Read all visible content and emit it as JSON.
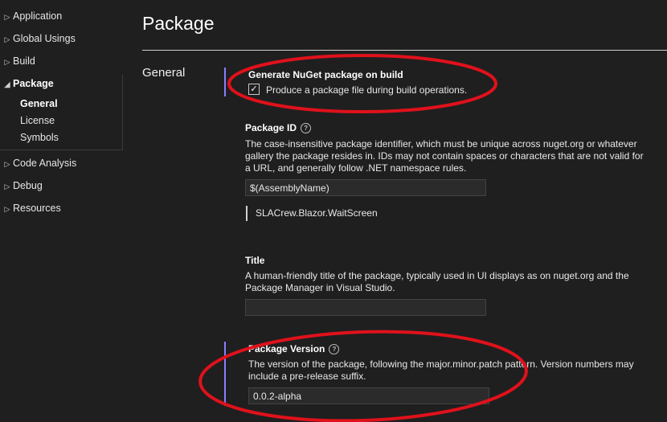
{
  "sidebar": {
    "items": [
      {
        "label": "Application"
      },
      {
        "label": "Global Usings"
      },
      {
        "label": "Build"
      },
      {
        "label": "Package"
      },
      {
        "label": "Code Analysis"
      },
      {
        "label": "Debug"
      },
      {
        "label": "Resources"
      }
    ],
    "package_children": [
      {
        "label": "General"
      },
      {
        "label": "License"
      },
      {
        "label": "Symbols"
      }
    ]
  },
  "header": {
    "title": "Package",
    "section": "General"
  },
  "settings": {
    "generate": {
      "name": "Generate NuGet package on build",
      "checkbox_label": "Produce a package file during build operations.",
      "checked": true
    },
    "package_id": {
      "name": "Package ID",
      "help_icon": "?",
      "description": "The case-insensitive package identifier, which must be unique across nuget.org or whatever gallery the package resides in. IDs may not contain spaces or characters that are not valid for a URL, and generally follow .NET namespace rules.",
      "value": "$(AssemblyName)",
      "evaluated": "SLACrew.Blazor.WaitScreen"
    },
    "title": {
      "name": "Title",
      "description": "A human-friendly title of the package, typically used in UI displays as on nuget.org and the Package Manager in Visual Studio.",
      "value": ""
    },
    "package_version": {
      "name": "Package Version",
      "help_icon": "?",
      "description": "The version of the package, following the major.minor.patch pattern. Version numbers may include a pre-release suffix.",
      "value": "0.0.2-alpha"
    }
  },
  "colors": {
    "background": "#1f1f1f",
    "accent": "#8a7dff",
    "annotation": "#e0111b"
  }
}
